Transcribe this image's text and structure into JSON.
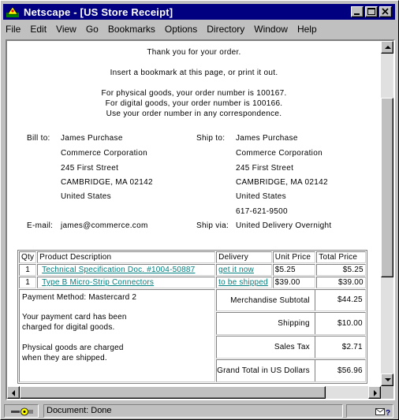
{
  "window": {
    "title": "Netscape - [US Store Receipt]"
  },
  "menu": [
    "File",
    "Edit",
    "View",
    "Go",
    "Bookmarks",
    "Options",
    "Directory",
    "Window",
    "Help"
  ],
  "header_lines": [
    "Thank you for your order.",
    "Insert a bookmark at this page, or print it out.",
    "For physical goods, your order number is 100167.",
    "For digital goods, your order number is 100166.",
    "Use your order number in any correspondence."
  ],
  "bill_to": {
    "label": "Bill to:",
    "lines": [
      "James Purchase",
      "Commerce Corporation",
      "245 First Street",
      "CAMBRIDGE, MA 02142",
      "United States"
    ]
  },
  "ship_to": {
    "label": "Ship to:",
    "lines": [
      "James Purchase",
      "Commerce Corporation",
      "245 First Street",
      "CAMBRIDGE, MA 02142",
      "United States",
      "617-621-9500"
    ]
  },
  "email": {
    "label": "E-mail:",
    "value": "james@commerce.com"
  },
  "ship_via": {
    "label": "Ship via:",
    "value": "United Delivery Overnight"
  },
  "table": {
    "headers": {
      "qty": "Qty",
      "desc": "Product Description",
      "delivery": "Delivery",
      "unit": "Unit Price",
      "total": "Total Price"
    },
    "rows": [
      {
        "qty": "1",
        "desc": "Technical Specification Doc. #1004-50887",
        "delivery": "get it now",
        "unit": "$5.25",
        "total": "$5.25"
      },
      {
        "qty": "1",
        "desc": "Type B Micro-Strip Connectors",
        "delivery": "to be shipped",
        "unit": "$39.00",
        "total": "$39.00"
      }
    ],
    "payment_method": "Payment Method: Mastercard 2",
    "note1": "Your payment card has been charged for digital goods.",
    "note2": "Physical goods are charged when they are shipped.",
    "summary": {
      "subtotal_label": "Merchandise Subtotal",
      "subtotal": "$44.25",
      "shipping_label": "Shipping",
      "shipping": "$10.00",
      "tax_label": "Sales Tax",
      "tax": "$2.71",
      "grand_label": "Grand Total in US Dollars",
      "grand": "$56.96"
    }
  },
  "status": {
    "text": "Document: Done"
  },
  "colors": {
    "titlebar": "#000080",
    "link": "#008080",
    "chrome": "#c0c0c0"
  }
}
